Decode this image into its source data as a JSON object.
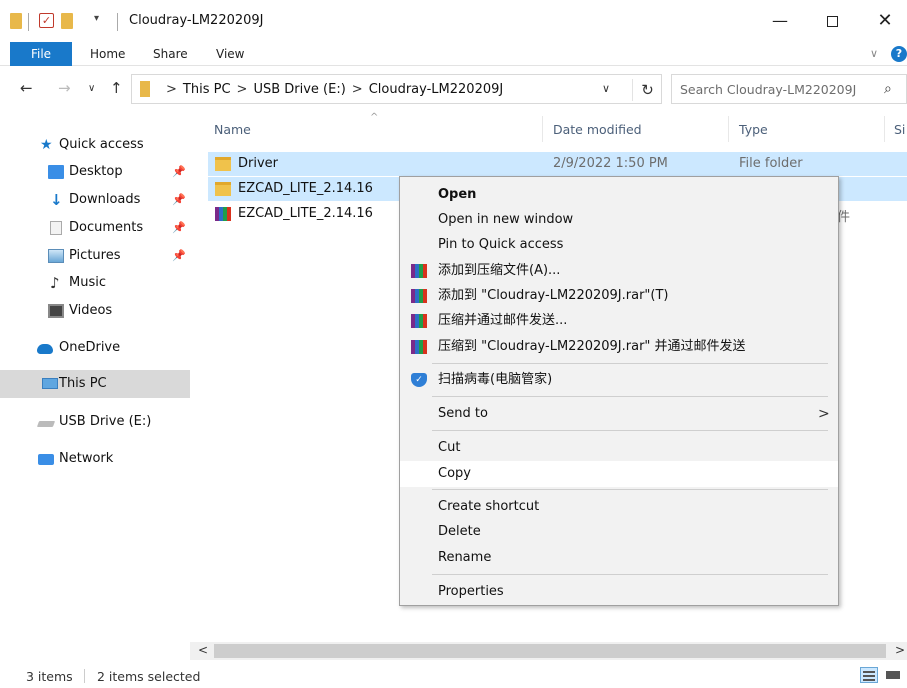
{
  "window": {
    "title": "Cloudray-LM220209J",
    "minimize": "—",
    "close": "✕"
  },
  "ribbon": {
    "tabs": [
      "File",
      "Home",
      "Share",
      "View"
    ],
    "help": "?"
  },
  "address": {
    "crumbs": [
      "This PC",
      "USB Drive (E:)",
      "Cloudray-LM220209J"
    ],
    "search_placeholder": "Search Cloudray-LM220209J"
  },
  "nav_pane": {
    "items": [
      {
        "label": "Quick access",
        "icon": "star-icon"
      },
      {
        "label": "Desktop",
        "icon": "desktop-icon",
        "pinned": true
      },
      {
        "label": "Downloads",
        "icon": "download-icon",
        "pinned": true
      },
      {
        "label": "Documents",
        "icon": "document-icon",
        "pinned": true
      },
      {
        "label": "Pictures",
        "icon": "pictures-icon",
        "pinned": true
      },
      {
        "label": "Music",
        "icon": "music-icon"
      },
      {
        "label": "Videos",
        "icon": "videos-icon"
      },
      {
        "label": "OneDrive",
        "icon": "cloud-icon"
      },
      {
        "label": "This PC",
        "icon": "computer-icon",
        "selected": true
      },
      {
        "label": "USB Drive (E:)",
        "icon": "usb-drive-icon"
      },
      {
        "label": "Network",
        "icon": "network-icon"
      }
    ]
  },
  "columns": [
    "Name",
    "Date modified",
    "Type",
    "Si"
  ],
  "files": [
    {
      "name": "Driver",
      "date": "2/9/2022 1:50 PM",
      "type": "File folder",
      "icon": "folder-icon",
      "selected": true
    },
    {
      "name": "EZCAD_LITE_2.14.16",
      "date": "",
      "type": "",
      "icon": "folder-icon",
      "selected": true
    },
    {
      "name": "EZCAD_LITE_2.14.16",
      "date": "",
      "type": "缩文件",
      "icon": "rar-archive-icon",
      "selected": false
    }
  ],
  "context_menu": {
    "open": "Open",
    "open_new_window": "Open in new window",
    "pin_quick_access": "Pin to Quick access",
    "rar_add": "添加到压缩文件(A)...",
    "rar_add_named": "添加到 \"Cloudray-LM220209J.rar\"(T)",
    "rar_email": "压缩并通过邮件发送...",
    "rar_email_named": "压缩到 \"Cloudray-LM220209J.rar\" 并通过邮件发送",
    "scan": "扫描病毒(电脑管家)",
    "send_to": "Send to",
    "cut": "Cut",
    "copy": "Copy",
    "create_shortcut": "Create shortcut",
    "delete": "Delete",
    "rename": "Rename",
    "properties": "Properties"
  },
  "status": {
    "item_count": "3 items",
    "selection": "2 items selected"
  }
}
